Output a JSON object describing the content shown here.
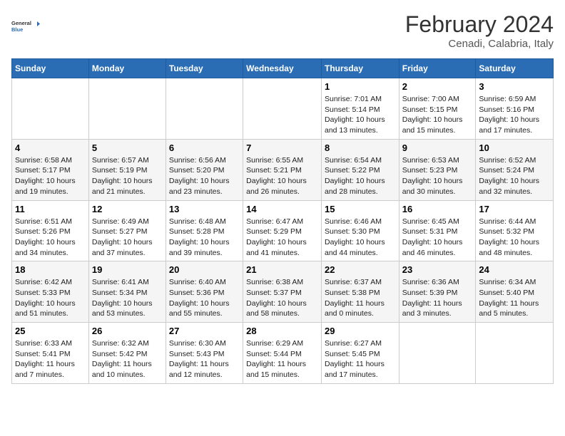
{
  "header": {
    "logo_general": "General",
    "logo_blue": "Blue",
    "title": "February 2024",
    "subtitle": "Cenadi, Calabria, Italy"
  },
  "weekdays": [
    "Sunday",
    "Monday",
    "Tuesday",
    "Wednesday",
    "Thursday",
    "Friday",
    "Saturday"
  ],
  "weeks": [
    [
      {
        "day": "",
        "info": ""
      },
      {
        "day": "",
        "info": ""
      },
      {
        "day": "",
        "info": ""
      },
      {
        "day": "",
        "info": ""
      },
      {
        "day": "1",
        "info": "Sunrise: 7:01 AM\nSunset: 5:14 PM\nDaylight: 10 hours\nand 13 minutes."
      },
      {
        "day": "2",
        "info": "Sunrise: 7:00 AM\nSunset: 5:15 PM\nDaylight: 10 hours\nand 15 minutes."
      },
      {
        "day": "3",
        "info": "Sunrise: 6:59 AM\nSunset: 5:16 PM\nDaylight: 10 hours\nand 17 minutes."
      }
    ],
    [
      {
        "day": "4",
        "info": "Sunrise: 6:58 AM\nSunset: 5:17 PM\nDaylight: 10 hours\nand 19 minutes."
      },
      {
        "day": "5",
        "info": "Sunrise: 6:57 AM\nSunset: 5:19 PM\nDaylight: 10 hours\nand 21 minutes."
      },
      {
        "day": "6",
        "info": "Sunrise: 6:56 AM\nSunset: 5:20 PM\nDaylight: 10 hours\nand 23 minutes."
      },
      {
        "day": "7",
        "info": "Sunrise: 6:55 AM\nSunset: 5:21 PM\nDaylight: 10 hours\nand 26 minutes."
      },
      {
        "day": "8",
        "info": "Sunrise: 6:54 AM\nSunset: 5:22 PM\nDaylight: 10 hours\nand 28 minutes."
      },
      {
        "day": "9",
        "info": "Sunrise: 6:53 AM\nSunset: 5:23 PM\nDaylight: 10 hours\nand 30 minutes."
      },
      {
        "day": "10",
        "info": "Sunrise: 6:52 AM\nSunset: 5:24 PM\nDaylight: 10 hours\nand 32 minutes."
      }
    ],
    [
      {
        "day": "11",
        "info": "Sunrise: 6:51 AM\nSunset: 5:26 PM\nDaylight: 10 hours\nand 34 minutes."
      },
      {
        "day": "12",
        "info": "Sunrise: 6:49 AM\nSunset: 5:27 PM\nDaylight: 10 hours\nand 37 minutes."
      },
      {
        "day": "13",
        "info": "Sunrise: 6:48 AM\nSunset: 5:28 PM\nDaylight: 10 hours\nand 39 minutes."
      },
      {
        "day": "14",
        "info": "Sunrise: 6:47 AM\nSunset: 5:29 PM\nDaylight: 10 hours\nand 41 minutes."
      },
      {
        "day": "15",
        "info": "Sunrise: 6:46 AM\nSunset: 5:30 PM\nDaylight: 10 hours\nand 44 minutes."
      },
      {
        "day": "16",
        "info": "Sunrise: 6:45 AM\nSunset: 5:31 PM\nDaylight: 10 hours\nand 46 minutes."
      },
      {
        "day": "17",
        "info": "Sunrise: 6:44 AM\nSunset: 5:32 PM\nDaylight: 10 hours\nand 48 minutes."
      }
    ],
    [
      {
        "day": "18",
        "info": "Sunrise: 6:42 AM\nSunset: 5:33 PM\nDaylight: 10 hours\nand 51 minutes."
      },
      {
        "day": "19",
        "info": "Sunrise: 6:41 AM\nSunset: 5:34 PM\nDaylight: 10 hours\nand 53 minutes."
      },
      {
        "day": "20",
        "info": "Sunrise: 6:40 AM\nSunset: 5:36 PM\nDaylight: 10 hours\nand 55 minutes."
      },
      {
        "day": "21",
        "info": "Sunrise: 6:38 AM\nSunset: 5:37 PM\nDaylight: 10 hours\nand 58 minutes."
      },
      {
        "day": "22",
        "info": "Sunrise: 6:37 AM\nSunset: 5:38 PM\nDaylight: 11 hours\nand 0 minutes."
      },
      {
        "day": "23",
        "info": "Sunrise: 6:36 AM\nSunset: 5:39 PM\nDaylight: 11 hours\nand 3 minutes."
      },
      {
        "day": "24",
        "info": "Sunrise: 6:34 AM\nSunset: 5:40 PM\nDaylight: 11 hours\nand 5 minutes."
      }
    ],
    [
      {
        "day": "25",
        "info": "Sunrise: 6:33 AM\nSunset: 5:41 PM\nDaylight: 11 hours\nand 7 minutes."
      },
      {
        "day": "26",
        "info": "Sunrise: 6:32 AM\nSunset: 5:42 PM\nDaylight: 11 hours\nand 10 minutes."
      },
      {
        "day": "27",
        "info": "Sunrise: 6:30 AM\nSunset: 5:43 PM\nDaylight: 11 hours\nand 12 minutes."
      },
      {
        "day": "28",
        "info": "Sunrise: 6:29 AM\nSunset: 5:44 PM\nDaylight: 11 hours\nand 15 minutes."
      },
      {
        "day": "29",
        "info": "Sunrise: 6:27 AM\nSunset: 5:45 PM\nDaylight: 11 hours\nand 17 minutes."
      },
      {
        "day": "",
        "info": ""
      },
      {
        "day": "",
        "info": ""
      }
    ]
  ]
}
